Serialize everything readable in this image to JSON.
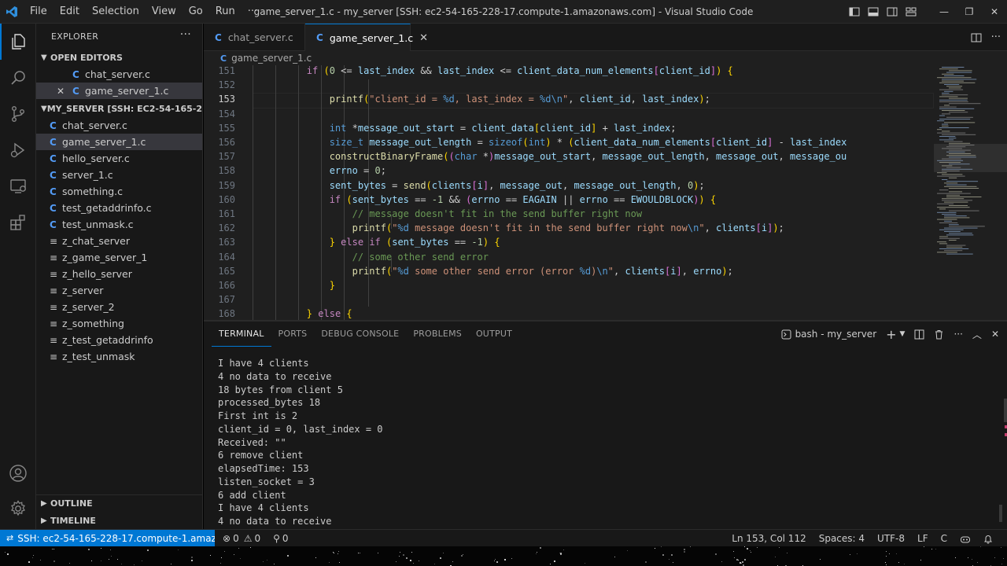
{
  "window": {
    "title": "game_server_1.c - my_server [SSH: ec2-54-165-228-17.compute-1.amazonaws.com] - Visual Studio Code",
    "menu": [
      "File",
      "Edit",
      "Selection",
      "View",
      "Go",
      "Run",
      "···"
    ]
  },
  "sidebar": {
    "header": "EXPLORER",
    "more": "···",
    "open_editors_label": "OPEN EDITORS",
    "open_editors": [
      "chat_server.c",
      "game_server_1.c"
    ],
    "folder_label": "MY_SERVER [SSH: EC2-54-165-228-1...",
    "files": [
      {
        "name": "chat_server.c",
        "kind": "c"
      },
      {
        "name": "game_server_1.c",
        "kind": "c"
      },
      {
        "name": "hello_server.c",
        "kind": "c"
      },
      {
        "name": "server_1.c",
        "kind": "c"
      },
      {
        "name": "something.c",
        "kind": "c"
      },
      {
        "name": "test_getaddrinfo.c",
        "kind": "c"
      },
      {
        "name": "test_unmask.c",
        "kind": "c"
      },
      {
        "name": "z_chat_server",
        "kind": "bin"
      },
      {
        "name": "z_game_server_1",
        "kind": "bin"
      },
      {
        "name": "z_hello_server",
        "kind": "bin"
      },
      {
        "name": "z_server",
        "kind": "bin"
      },
      {
        "name": "z_server_2",
        "kind": "bin"
      },
      {
        "name": "z_something",
        "kind": "bin"
      },
      {
        "name": "z_test_getaddrinfo",
        "kind": "bin"
      },
      {
        "name": "z_test_unmask",
        "kind": "bin"
      }
    ],
    "outline_label": "OUTLINE",
    "timeline_label": "TIMELINE"
  },
  "tabs": [
    {
      "label": "chat_server.c",
      "active": false
    },
    {
      "label": "game_server_1.c",
      "active": true
    }
  ],
  "breadcrumb": "game_server_1.c",
  "editor": {
    "current_line": 153,
    "line_numbers": [
      "151",
      "152",
      "153",
      "154",
      "155",
      "156",
      "157",
      "158",
      "159",
      "160",
      "161",
      "162",
      "163",
      "164",
      "165",
      "166",
      "167",
      "168"
    ],
    "lines": [
      "        if (0 <= last_index && last_index <= client_data_num_elements[client_id]) {",
      "",
      "            printf(\"client_id = %d, last_index = %d\\n\", client_id, last_index);",
      "",
      "            int *message_out_start = client_data[client_id] + last_index;",
      "            size_t message_out_length = sizeof(int) * (client_data_num_elements[client_id] - last_index",
      "            constructBinaryFrame((char *)message_out_start, message_out_length, message_out, message_ou",
      "            errno = 0;",
      "            sent_bytes = send(clients[i], message_out, message_out_length, 0);",
      "            if (sent_bytes == -1 && (errno == EAGAIN || errno == EWOULDBLOCK)) {",
      "                // message doesn't fit in the send buffer right now",
      "                printf(\"%d message doesn't fit in the send buffer right now\\n\", clients[i]);",
      "            } else if (sent_bytes == -1) {",
      "                // some other send error",
      "                printf(\"%d some other send error (error %d)\\n\", clients[i], errno);",
      "            }",
      "",
      "        } else {"
    ]
  },
  "panel": {
    "tabs": [
      "TERMINAL",
      "PORTS",
      "DEBUG CONSOLE",
      "PROBLEMS",
      "OUTPUT"
    ],
    "active_tab": "TERMINAL",
    "terminal_name": "bash - my_server",
    "terminal_lines": [
      "I have 4 clients",
      "4 no data to receive",
      "18 bytes from client 5",
      "processed_bytes 18",
      "First int is 2",
      "client_id = 0, last_index = 0",
      "Received: \"\"",
      "6 remove client",
      "elapsedTime: 153",
      "listen_socket = 3",
      "6 add client",
      "I have 4 clients",
      "4 no data to receive"
    ]
  },
  "statusbar": {
    "remote": "SSH: ec2-54-165-228-17.compute-1.amazona...",
    "errors": "0",
    "warnings": "0",
    "ports": "0",
    "cursor": "Ln 153, Col 112",
    "spaces": "Spaces: 4",
    "encoding": "UTF-8",
    "eol": "LF",
    "language": "C"
  },
  "colors": {
    "accent": "#0078d4",
    "background": "#1f1f1f",
    "sidebar": "#181818"
  }
}
